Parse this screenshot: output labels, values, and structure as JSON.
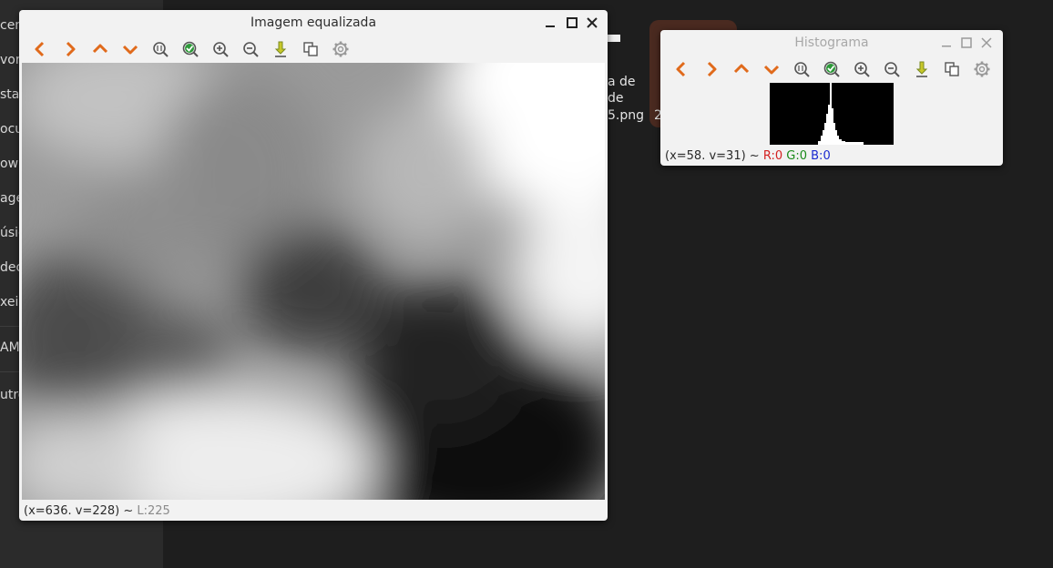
{
  "sidebar": {
    "items": [
      {
        "label": "cen"
      },
      {
        "label": "vor"
      },
      {
        "label": "sta"
      },
      {
        "label": "ocu"
      },
      {
        "label": "own"
      },
      {
        "label": "age"
      },
      {
        "label": "úsic"
      },
      {
        "label": "deo"
      },
      {
        "label": "xeir"
      },
      {
        "label": "AMS"
      },
      {
        "label": "utro"
      }
    ]
  },
  "desktop": {
    "file_label_lines": [
      "a de",
      "de",
      "5.png"
    ],
    "thumb_label": "2"
  },
  "image_window": {
    "title": "Imagem equalizada",
    "status": {
      "coords": "(x=636. v=228) ~ ",
      "value": "L:225"
    }
  },
  "histogram_window": {
    "title": "Histograma",
    "status": {
      "coords": "(x=58. v=31) ~ ",
      "r": "R:0",
      "g": "G:0",
      "b": "B:0"
    }
  },
  "toolbar": {
    "buttons": [
      {
        "name": "pan-left",
        "icon": "chevron-left-icon"
      },
      {
        "name": "pan-right",
        "icon": "chevron-right-icon"
      },
      {
        "name": "pan-up",
        "icon": "chevron-up-icon"
      },
      {
        "name": "pan-down",
        "icon": "chevron-down-icon"
      },
      {
        "name": "zoom-original",
        "icon": "zoom-1to1-icon"
      },
      {
        "name": "zoom-fit",
        "icon": "zoom-fit-check-icon"
      },
      {
        "name": "zoom-in",
        "icon": "zoom-in-icon"
      },
      {
        "name": "zoom-out",
        "icon": "zoom-out-icon"
      },
      {
        "name": "save",
        "icon": "download-arrow-icon"
      },
      {
        "name": "copy",
        "icon": "copy-icon"
      },
      {
        "name": "properties",
        "icon": "gear-icon"
      }
    ]
  },
  "colors": {
    "orange": "#e06a1b",
    "green": "#2e9a3a",
    "yellow": "#c8c82a",
    "red_channel": "#d32020",
    "green_channel": "#1a8a1a",
    "blue_channel": "#1a2ad0"
  }
}
